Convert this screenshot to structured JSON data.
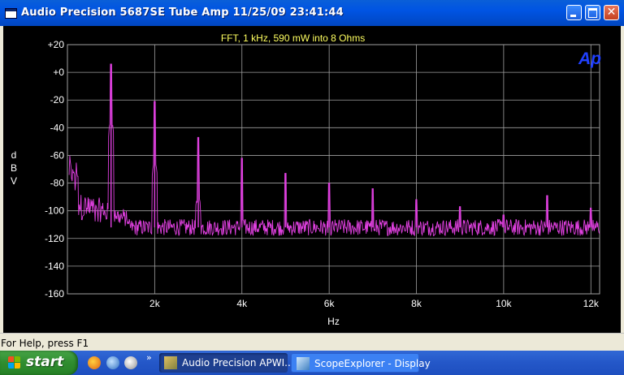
{
  "window": {
    "title": "Audio Precision  5687SE Tube Amp  11/25/09 23:41:44"
  },
  "status_bar": {
    "text": "For Help, press F1"
  },
  "taskbar": {
    "start_label": "start",
    "tasks": [
      {
        "label": "Audio Precision APWI...",
        "icon": "ap-win-icon",
        "active": true
      },
      {
        "label": "ScopeExplorer - Display",
        "icon": "scope-explorer-icon",
        "active": false
      }
    ],
    "chevron": "»"
  },
  "colors": {
    "trace": "#e040e0",
    "plot_title": "#ffff60",
    "grid": "#a0a0a0",
    "logo": "#2040ff",
    "background": "#000000"
  },
  "chart_data": {
    "type": "line",
    "title": "FFT, 1 kHz, 590 mW into 8 Ohms",
    "xlabel": "Hz",
    "ylabel": "dBV",
    "xlim": [
      0,
      12200
    ],
    "ylim": [
      -160,
      20
    ],
    "x_ticks": [
      2000,
      4000,
      6000,
      8000,
      10000,
      12000
    ],
    "x_tick_labels": [
      "2k",
      "4k",
      "6k",
      "8k",
      "10k",
      "12k"
    ],
    "y_ticks": [
      20,
      0,
      -20,
      -40,
      -60,
      -80,
      -100,
      -120,
      -140,
      -160
    ],
    "y_tick_labels": [
      "+20",
      "+0",
      "-20",
      "-40",
      "-60",
      "-80",
      "-100",
      "-120",
      "-140",
      "-160"
    ],
    "grid": true,
    "logo": "Ap",
    "series": [
      {
        "harmonics": [
          {
            "x": 1000,
            "y": 6
          },
          {
            "x": 2000,
            "y": -21
          },
          {
            "x": 3000,
            "y": -47
          },
          {
            "x": 4000,
            "y": -62
          },
          {
            "x": 5000,
            "y": -73
          },
          {
            "x": 6000,
            "y": -80
          },
          {
            "x": 7000,
            "y": -84
          },
          {
            "x": 8000,
            "y": -92
          },
          {
            "x": 9000,
            "y": -97
          },
          {
            "x": 10000,
            "y": -103
          },
          {
            "x": 11000,
            "y": -89
          },
          {
            "x": 12000,
            "y": -98
          }
        ],
        "noise_floor": -112
      }
    ]
  }
}
